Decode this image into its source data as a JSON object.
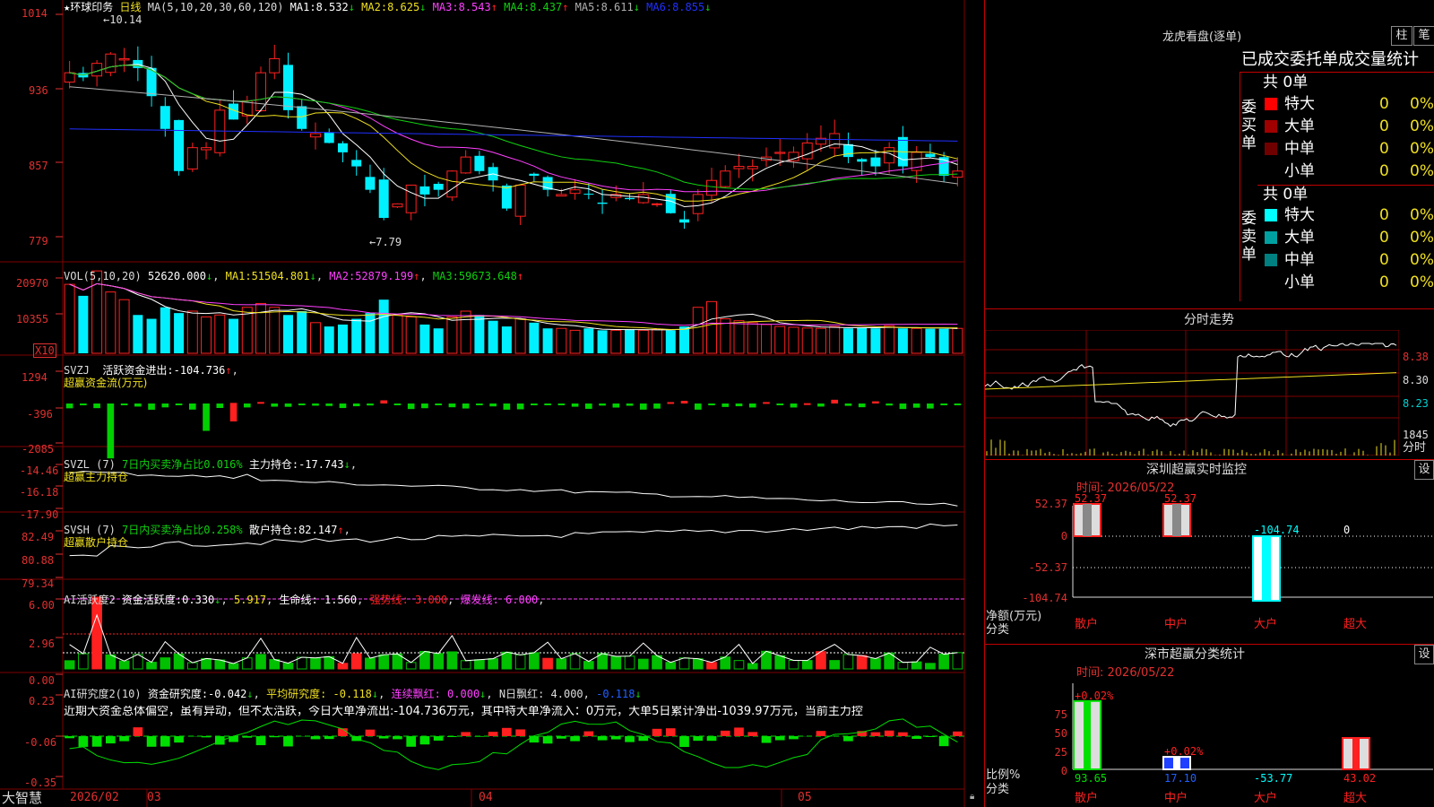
{
  "colors": {
    "up": "#ff2020",
    "down": "#00f0ff",
    "ma1": "#ffffff",
    "ma2": "#f0e020",
    "ma3": "#ff40ff",
    "ma4": "#10d010",
    "ma5": "#b0b0b0",
    "ma6": "#2030ff",
    "grid": "#800000",
    "axis": "#e03030"
  },
  "price_panel": {
    "stock": "★环球印务",
    "period": "日线",
    "ma_label": "MA(5,10,20,30,60,120)",
    "ma": [
      {
        "name": "MA1:",
        "value": "8.532",
        "arrow": "↓"
      },
      {
        "name": "MA2:",
        "value": "8.625",
        "arrow": "↓"
      },
      {
        "name": "MA3:",
        "value": "8.543",
        "arrow": "↑"
      },
      {
        "name": "MA4:",
        "value": "8.437",
        "arrow": "↑"
      },
      {
        "name": "MA5:",
        "value": "8.611",
        "arrow": "↓"
      },
      {
        "name": "MA6:",
        "value": "8.855",
        "arrow": "↓"
      }
    ],
    "y_ticks": [
      "1014",
      "936",
      "857",
      "779"
    ],
    "y_vals": [
      10.14,
      9.36,
      8.57,
      7.79
    ],
    "high_mark": "10.14",
    "low_mark": "7.79"
  },
  "vol_panel": {
    "label": "VOL(5,10,20)",
    "value": "52620.000",
    "arrow": "↓",
    "ma": [
      {
        "name": "MA1:",
        "value": "51504.801",
        "arrow": "↓"
      },
      {
        "name": "MA2:",
        "value": "52879.199",
        "arrow": "↑"
      },
      {
        "name": "MA3:",
        "value": "59673.648",
        "arrow": "↑"
      }
    ],
    "y_ticks": [
      "20970",
      "10355"
    ],
    "unit": "X10"
  },
  "svzj": {
    "label": "SVZJ",
    "name": "活跃资金进出:",
    "value": "-104.736",
    "arrow": "↑",
    "sub": "超赢资金流(万元)",
    "y_ticks": [
      "1294",
      "-396",
      "-2085"
    ]
  },
  "svzl": {
    "label": "SVZL (7)",
    "ratio": "7日内买卖净占比0.016%",
    "name": "主力持仓:",
    "value": "-17.743",
    "arrow": "↓",
    "sub": "超赢主力持仓",
    "y_ticks": [
      "-14.46",
      "-16.18",
      "-17.90"
    ]
  },
  "svsh": {
    "label": "SVSH (7)",
    "ratio": "7日内买卖净占比0.258%",
    "name": "散户持仓:",
    "value": "82.147",
    "arrow": "↑",
    "sub": "超赢散户持仓",
    "y_ticks": [
      "82.49",
      "80.88",
      "79.34"
    ]
  },
  "ai1": {
    "label": "AI活跃度2",
    "name": "资金活跃度:",
    "value": "0.330",
    "arrow": "↓",
    "v2": "5.917",
    "life": "生命线: 1.560",
    "strong": "强势线: 3.000",
    "burst": "爆发线: 6.000",
    "y_ticks": [
      "6.00",
      "2.96",
      "0.00"
    ]
  },
  "ai2": {
    "label": "AI研究度2(10)",
    "name": "资金研究度:",
    "value": "-0.042",
    "arrow": "↓",
    "avg": "平均研究度: -0.118",
    "cont": "连续飘红: 0.000",
    "n": "N日飘红: 4.000",
    "last": "-0.118",
    "y_ticks": [
      "0.23",
      "-0.06",
      "-0.35"
    ],
    "comment": "近期大资金总体偏空，虽有异动，但不太活跃，今日大单净流出:-104.736万元，其中特大单净流入：0万元，大单5日累计净出-1039.97万元，当前主力控"
  },
  "bottom": {
    "brand": "大智慧",
    "dates": [
      "2026/02",
      "03",
      "04",
      "05"
    ]
  },
  "lhb": {
    "title": "龙虎看盘(逐单)",
    "btn1": "柱",
    "btn2": "笔",
    "header": "已成交委托单成交量统计",
    "buy": {
      "label": "委买单",
      "total": "共 0单",
      "rows": [
        {
          "name": "特大",
          "n": "0",
          "p": "0%",
          "color": "#ff0000"
        },
        {
          "name": "大单",
          "n": "0",
          "p": "0%",
          "color": "#a00000"
        },
        {
          "name": "中单",
          "n": "0",
          "p": "0%",
          "color": "#700000"
        },
        {
          "name": "小单",
          "n": "0",
          "p": "0%",
          "color": "#000000"
        }
      ]
    },
    "sell": {
      "label": "委卖单",
      "total": "共 0单",
      "rows": [
        {
          "name": "特大",
          "n": "0",
          "p": "0%",
          "color": "#00ffff"
        },
        {
          "name": "大单",
          "n": "0",
          "p": "0%",
          "color": "#00a0a0"
        },
        {
          "name": "中单",
          "n": "0",
          "p": "0%",
          "color": "#008080"
        },
        {
          "name": "小单",
          "n": "0",
          "p": "0%",
          "color": "#000000"
        }
      ]
    }
  },
  "fenshi": {
    "title": "分时走势",
    "prices": [
      "8.38",
      "8.30",
      "8.23"
    ],
    "vol": "1845",
    "vol_unit": "分时"
  },
  "monitor": {
    "title": "深圳超赢实时监控",
    "set": "设",
    "time": "时间: 2026/05/22",
    "y_ticks": [
      "52.37",
      "0",
      "-52.37",
      "-104.74"
    ],
    "ylabel1": "净额(万元)",
    "ylabel2": "分类",
    "bars": [
      {
        "cat": "散户",
        "value": 52.37,
        "label": "52.37"
      },
      {
        "cat": "中户",
        "value": 52.37,
        "label": "52.37"
      },
      {
        "cat": "大户",
        "value": -104.74,
        "label": "-104.74"
      },
      {
        "cat": "超大",
        "value": 0,
        "label": "0"
      }
    ]
  },
  "classify": {
    "title": "深市超赢分类统计",
    "set": "设",
    "time": "时间: 2026/05/22",
    "y_ticks": [
      "75",
      "50",
      "25",
      "0"
    ],
    "ylabel1": "比例%",
    "ylabel2": "分类",
    "bars": [
      {
        "cat": "散户",
        "value": 93.65,
        "label": "93.65",
        "top": "+0.02%"
      },
      {
        "cat": "中户",
        "value": 17.1,
        "label": "17.10",
        "top": "+0.02%"
      },
      {
        "cat": "大户",
        "value": -53.77,
        "label": "-53.77",
        "top": ""
      },
      {
        "cat": "超大",
        "value": 43.02,
        "label": "43.02",
        "top": ""
      }
    ]
  }
}
